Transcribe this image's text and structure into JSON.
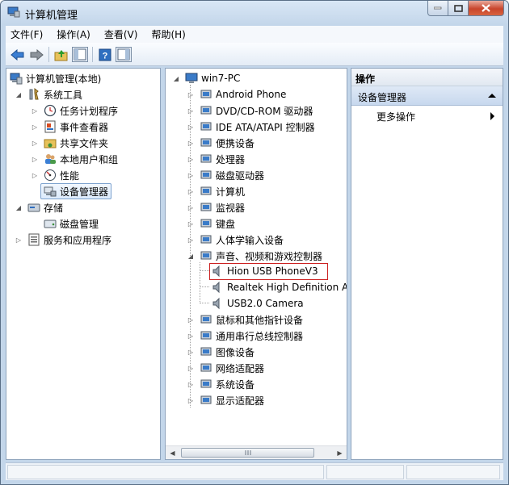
{
  "window": {
    "title": "计算机管理"
  },
  "menu": [
    "文件(F)",
    "操作(A)",
    "查看(V)",
    "帮助(H)"
  ],
  "toolbar": {
    "buttons": [
      "back-icon",
      "forward-icon",
      "up-folder-icon",
      "show-hide-tree-icon",
      "help-icon",
      "show-hide-action-icon"
    ]
  },
  "left_tree": {
    "root": "计算机管理(本地)",
    "system_tools": "系统工具",
    "task_scheduler": "任务计划程序",
    "event_viewer": "事件查看器",
    "shared_folders": "共享文件夹",
    "local_users": "本地用户和组",
    "performance": "性能",
    "device_manager": "设备管理器",
    "storage": "存储",
    "disk_management": "磁盘管理",
    "services_apps": "服务和应用程序"
  },
  "device_tree": {
    "root": "win7-PC",
    "categories": [
      "Android Phone",
      "DVD/CD-ROM 驱动器",
      "IDE ATA/ATAPI 控制器",
      "便携设备",
      "处理器",
      "磁盘驱动器",
      "计算机",
      "监视器",
      "键盘",
      "人体学输入设备",
      "声音、视频和游戏控制器"
    ],
    "sound_children": [
      "Hion USB PhoneV3",
      "Realtek High Definition A",
      "USB2.0 Camera"
    ],
    "categories_after": [
      "鼠标和其他指针设备",
      "通用串行总线控制器",
      "图像设备",
      "网络适配器",
      "系统设备",
      "显示适配器"
    ]
  },
  "actions": {
    "header": "操作",
    "section": "设备管理器",
    "more": "更多操作"
  },
  "colors": {
    "highlight_border": "#cc2222",
    "selection_fill": "#dcebfc",
    "frame": "#c3d6ea"
  }
}
